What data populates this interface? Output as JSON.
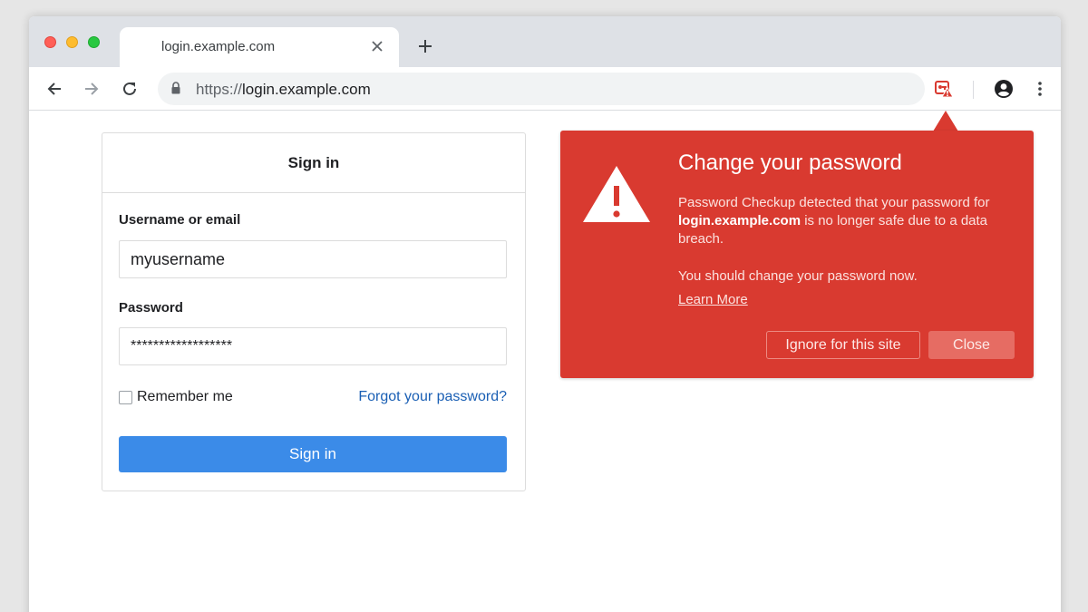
{
  "browser": {
    "tab": {
      "title": "login.example.com"
    },
    "address_bar": {
      "scheme": "https://",
      "host": "login.example.com"
    }
  },
  "login_card": {
    "heading": "Sign in",
    "username_label": "Username or email",
    "username_value": "myusername",
    "password_label": "Password",
    "password_value": "******************",
    "remember_label": "Remember me",
    "remember_checked": false,
    "forgot_link": "Forgot your password?",
    "submit_label": "Sign in"
  },
  "password_alert": {
    "title": "Change your password",
    "body_prefix": "Password Checkup detected that your password for ",
    "body_site": "login.example.com",
    "body_suffix": " is no longer safe due to a data breach.",
    "action_text": "You should change your password now.",
    "learn_more": "Learn More",
    "ignore_button": "Ignore for this site",
    "close_button": "Close",
    "accent_color": "#d93a30"
  },
  "colors": {
    "primary_button": "#3b8be8",
    "link": "#1a5fb4",
    "alert": "#d93a30"
  }
}
